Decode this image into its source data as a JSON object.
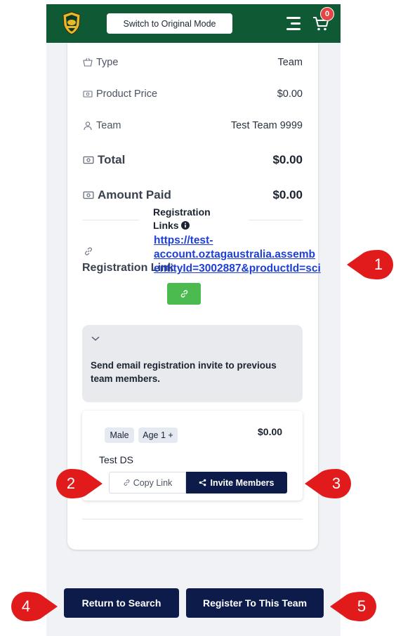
{
  "header": {
    "mode_button": "Switch to Original Mode",
    "cart_count": "0"
  },
  "summary": {
    "type_label": "Type",
    "type_value": "Team",
    "price_label": "Product Price",
    "price_value": "$0.00",
    "team_label": "Team",
    "team_value": "Test Team 9999",
    "total_label": "Total",
    "total_value": "$0.00",
    "paid_label": "Amount Paid",
    "paid_value": "$0.00"
  },
  "registration": {
    "links_title": "Registration Links",
    "label": "Registration Link",
    "url_line1": "https://test-",
    "url_line2": "account.oztagaustralia.assemb",
    "url_line3": "entityId=3002887&productId=sci"
  },
  "invite": {
    "text": "Send email registration invite to previous team members."
  },
  "team_card": {
    "tags": [
      "Male",
      "Age 1 +"
    ],
    "price": "$0.00",
    "name": "Test DS",
    "copy_label": "Copy Link",
    "invite_label": "Invite Members"
  },
  "actions": {
    "return_label": "Return to Search",
    "register_label": "Register To This Team"
  },
  "callouts": [
    "1",
    "2",
    "3",
    "4",
    "5"
  ],
  "colors": {
    "header_green": "#0f5a35",
    "navy": "#0c1b4a",
    "link_blue": "#1d3fd8",
    "copy_green": "#4cbb4f",
    "callout_red": "#e11b1b"
  }
}
